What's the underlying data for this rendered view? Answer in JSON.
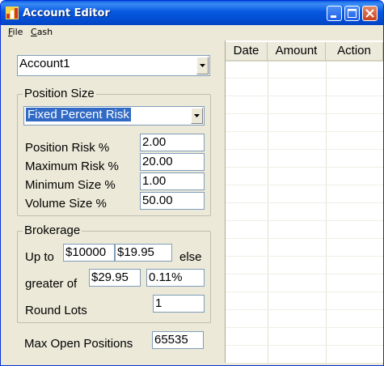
{
  "window": {
    "title": "Account Editor"
  },
  "menu": {
    "file": "F",
    "file_rest": "ile",
    "cash": "C",
    "cash_rest": "ash"
  },
  "account": {
    "selected": "Account1"
  },
  "position_size": {
    "legend": "Position Size",
    "method": "Fixed Percent Risk",
    "fields": [
      {
        "label": "Position Risk %",
        "value": "2.00"
      },
      {
        "label": "Maximum Risk %",
        "value": "20.00"
      },
      {
        "label": "Minimum Size %",
        "value": "1.00"
      },
      {
        "label": "Volume Size %",
        "value": "50.00"
      }
    ]
  },
  "brokerage": {
    "legend": "Brokerage",
    "up_to_label": "Up to",
    "up_to_threshold": "$10000",
    "up_to_fee": "$19.95",
    "else_label": "else",
    "greater_of_label": "greater of",
    "greater_fee": "$29.95",
    "greater_pct": "0.11%",
    "round_lots_label": "Round Lots",
    "round_lots_value": "1"
  },
  "max_open": {
    "label": "Max Open Positions",
    "value": "65535"
  },
  "table": {
    "columns": [
      "Date",
      "Amount",
      "Action"
    ]
  }
}
